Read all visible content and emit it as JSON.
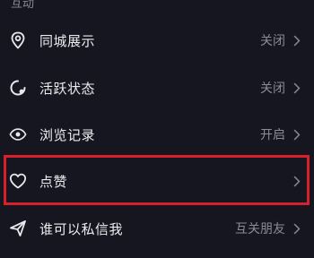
{
  "section": {
    "title": "互动"
  },
  "rows": [
    {
      "label": "同城展示",
      "value": "关闭",
      "icon": "location-pin-icon"
    },
    {
      "label": "活跃状态",
      "value": "关闭",
      "icon": "activity-status-icon"
    },
    {
      "label": "浏览记录",
      "value": "开启",
      "icon": "eye-icon"
    },
    {
      "label": "点赞",
      "value": "",
      "icon": "heart-icon"
    },
    {
      "label": "谁可以私信我",
      "value": "互关朋友",
      "icon": "send-message-icon"
    }
  ],
  "colors": {
    "background": "#15161f",
    "text": "#ececf0",
    "muted": "#8a8b94",
    "highlight": "#d9202a"
  }
}
